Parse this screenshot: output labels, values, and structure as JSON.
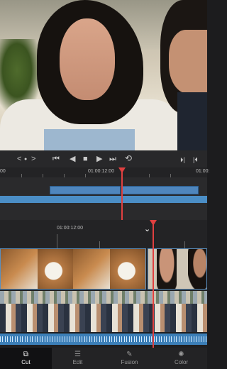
{
  "viewer": {
    "description_icon": "video-frame"
  },
  "transport": {
    "nav_prev": "<",
    "nav_dot": "●",
    "nav_next": ">",
    "to_start": "⏮",
    "play_back": "◀",
    "stop": "■",
    "play": "▶",
    "to_end": "⏭",
    "loop": "⟲",
    "prev_marker": "⏵|",
    "next_marker": "|⏴"
  },
  "upper_timeline": {
    "timecode_left": "00",
    "timecode_mid": "01:00:12:00",
    "timecode_right": "01:00:"
  },
  "lower_timeline": {
    "timecode": "01:00:12:00",
    "chevron": "⌄"
  },
  "nav": {
    "items": [
      {
        "label": "Cut",
        "icon": "⧉",
        "active": true
      },
      {
        "label": "Edit",
        "icon": "☰",
        "active": false
      },
      {
        "label": "Fusion",
        "icon": "✎",
        "active": false
      },
      {
        "label": "Color",
        "icon": "✺",
        "active": false
      }
    ]
  }
}
